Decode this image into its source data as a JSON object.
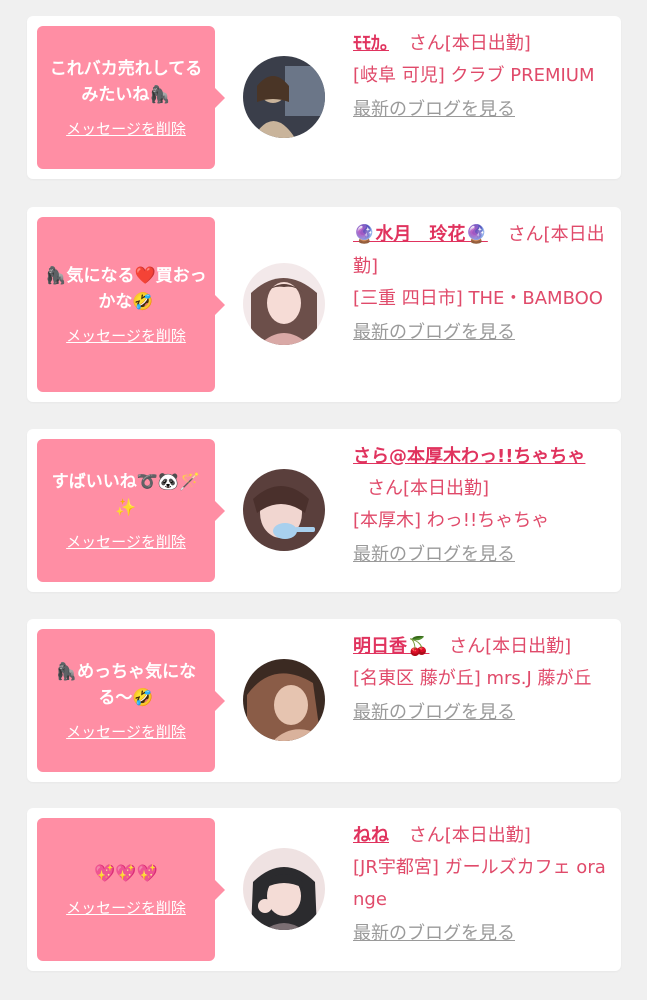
{
  "messages": [
    {
      "bubble_text": "これバカ売れしてるみたいね🦍",
      "delete_label": "メッセージを削除",
      "name": "ﾓﾓｶ｡",
      "suffix": "さん[本日出勤]",
      "store": "[岐阜 可児] クラブ PREMIUM",
      "blog_label": "最新のブログを見る",
      "avatar_colors": [
        "#3a3e4a",
        "#c9b49b",
        "#6b7688"
      ]
    },
    {
      "bubble_text": "🦍気になる❤️買おっかな🤣",
      "delete_label": "メッセージを削除",
      "name": "🔮水月　玲花🔮",
      "suffix": "さん[本日出勤]",
      "store": "[三重 四日市] THE・BAMBOO",
      "blog_label": "最新のブログを見る",
      "avatar_colors": [
        "#f3e9ea",
        "#d9a9a6",
        "#6c4f4a"
      ]
    },
    {
      "bubble_text": "すばいいね➰🐼🪄✨",
      "delete_label": "メッセージを削除",
      "name": "さら@本厚木わっ!!ちゃちゃ",
      "suffix": "さん[本日出勤]",
      "store": "[本厚木] わっ!!ちゃちゃ",
      "blog_label": "最新のブログを見る",
      "avatar_colors": [
        "#5a3f3c",
        "#f1d6d0",
        "#a8d0ee"
      ]
    },
    {
      "bubble_text": "🦍めっちゃ気になる〜🤣",
      "delete_label": "メッセージを削除",
      "name": "明日香🍒",
      "suffix": "さん[本日出勤]",
      "store": "[名東区 藤が丘] mrs.J 藤が丘",
      "blog_label": "最新のブログを見る",
      "avatar_colors": [
        "#3b2a22",
        "#e6c4b0",
        "#8a5c47"
      ]
    },
    {
      "bubble_text": "💖💖💖",
      "delete_label": "メッセージを削除",
      "name": "ねね",
      "suffix": "さん[本日出勤]",
      "store": "[JR宇都宮] ガールズカフェ orange",
      "blog_label": "最新のブログを見る",
      "avatar_colors": [
        "#2b2b2e",
        "#efe2e2",
        "#7b6f73"
      ]
    }
  ],
  "colors": {
    "page_background": "#f0f0f0",
    "bubble": "#ff8ea4",
    "name": "#e0335e",
    "info_text": "#e04a6a",
    "blog_link": "#9a9a9a"
  }
}
